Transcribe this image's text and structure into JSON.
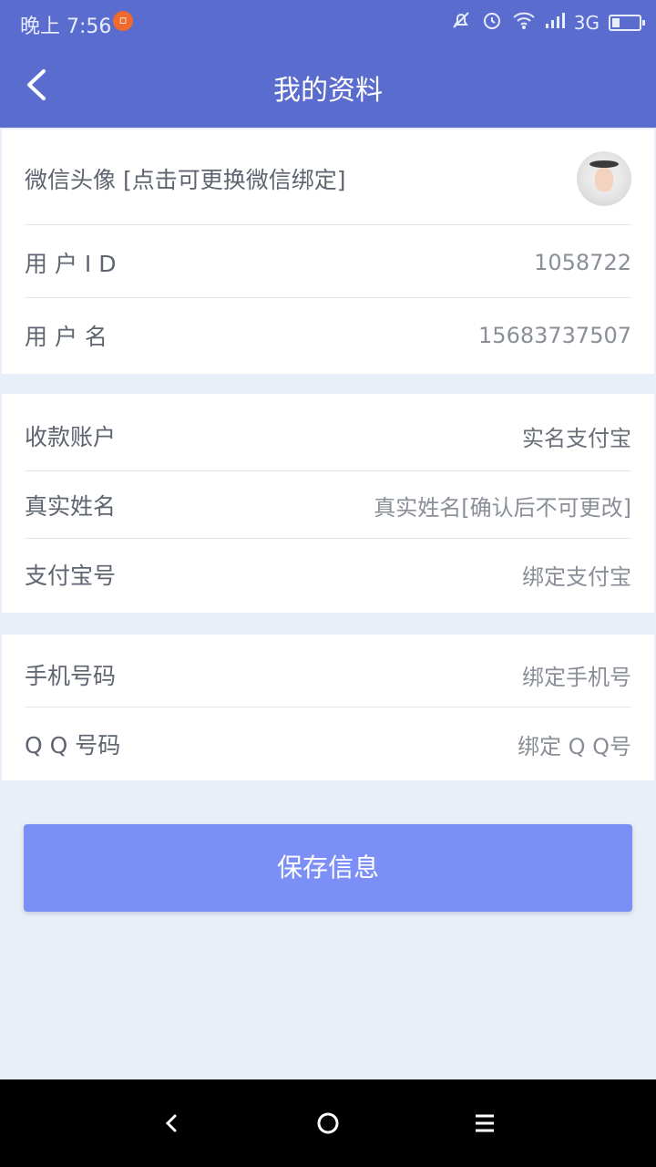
{
  "status_bar": {
    "time": "晚上 7:56",
    "network": "3G"
  },
  "header": {
    "title": "我的资料"
  },
  "profile": {
    "avatar_label": "微信头像 [点击可更换微信绑定]",
    "user_id_label": "用 户 I D",
    "user_id_value": "1058722",
    "username_label": "用 户 名",
    "username_value": "15683737507"
  },
  "account": {
    "account_label": "收款账户",
    "account_value": "实名支付宝",
    "realname_label": "真实姓名",
    "realname_placeholder": "真实姓名[确认后不可更改]",
    "alipay_label": "支付宝号",
    "alipay_placeholder": "绑定支付宝"
  },
  "contact": {
    "phone_label": "手机号码",
    "phone_placeholder": "绑定手机号",
    "qq_label": "Q Q 号码",
    "qq_placeholder": "绑定 Q Q号"
  },
  "save_button": {
    "label": "保存信息"
  },
  "colors": {
    "header": "#5b6ccf",
    "button": "#7b8ff7",
    "background": "#e9eff8"
  }
}
